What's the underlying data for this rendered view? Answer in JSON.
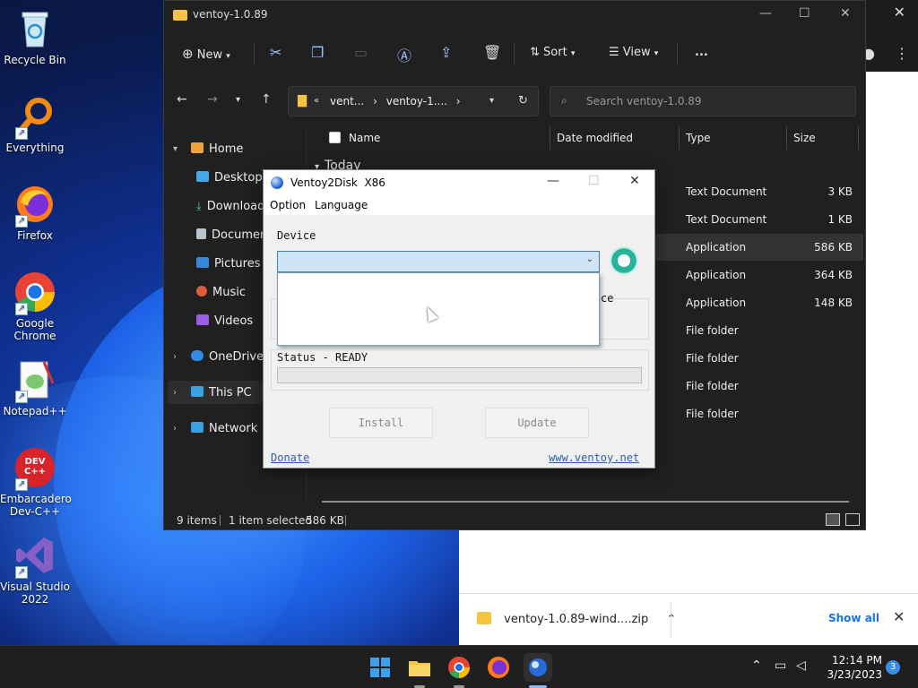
{
  "desktop": {
    "icons": [
      {
        "label": "Recycle Bin"
      },
      {
        "label": "Everything"
      },
      {
        "label": "Firefox"
      },
      {
        "label": "Google Chrome"
      },
      {
        "label": "Notepad++"
      },
      {
        "label": "Embarcadero Dev-C++"
      },
      {
        "label": "Visual Studio 2022"
      }
    ],
    "devcpp_logo": "DEV C++"
  },
  "explorer": {
    "title": "ventoy-1.0.89",
    "toolbar": {
      "new": "New",
      "sort": "Sort",
      "view": "View",
      "more": "..."
    },
    "address": {
      "part1": "vent...",
      "part2": "ventoy-1...."
    },
    "search_placeholder": "Search ventoy-1.0.89",
    "sidebar": {
      "home": "Home",
      "desktop": "Desktop",
      "downloads": "Downloads",
      "documents": "Documents",
      "pictures": "Pictures",
      "music": "Music",
      "videos": "Videos",
      "onedrive": "OneDrive",
      "thispc": "This PC",
      "network": "Network"
    },
    "columns": {
      "name": "Name",
      "date": "Date modified",
      "type": "Type",
      "size": "Size"
    },
    "group": "Today",
    "rows": [
      {
        "type": "Text Document",
        "size": "3 KB"
      },
      {
        "type": "Text Document",
        "size": "1 KB"
      },
      {
        "type": "Application",
        "size": "586 KB"
      },
      {
        "type": "Application",
        "size": "364 KB"
      },
      {
        "type": "Application",
        "size": "148 KB"
      },
      {
        "type": "File folder",
        "size": ""
      },
      {
        "type": "File folder",
        "size": ""
      },
      {
        "type": "File folder",
        "size": ""
      },
      {
        "type": "File folder",
        "size": ""
      }
    ],
    "status": {
      "items": "9 items",
      "selected": "1 item selected",
      "selected_size": "586 KB"
    }
  },
  "ventoy": {
    "title": "Ventoy2Disk  X86",
    "menu": {
      "option": "Option",
      "language": "Language"
    },
    "device_label": "Device",
    "partial_label": "ce",
    "status_label": "Status - READY",
    "install_label": "Install",
    "update_label": "Update",
    "donate_label": "Donate",
    "website_label": "www.ventoy.net"
  },
  "downloads": {
    "file": "ventoy-1.0.89-wind....zip",
    "show_all": "Show all"
  },
  "taskbar": {
    "time": "12:14 PM",
    "date": "3/23/2023",
    "notification_count": "3"
  },
  "colors": {
    "accent": "#3c7fc4",
    "link": "#2a5fb0",
    "selection": "#cfe3f7"
  }
}
